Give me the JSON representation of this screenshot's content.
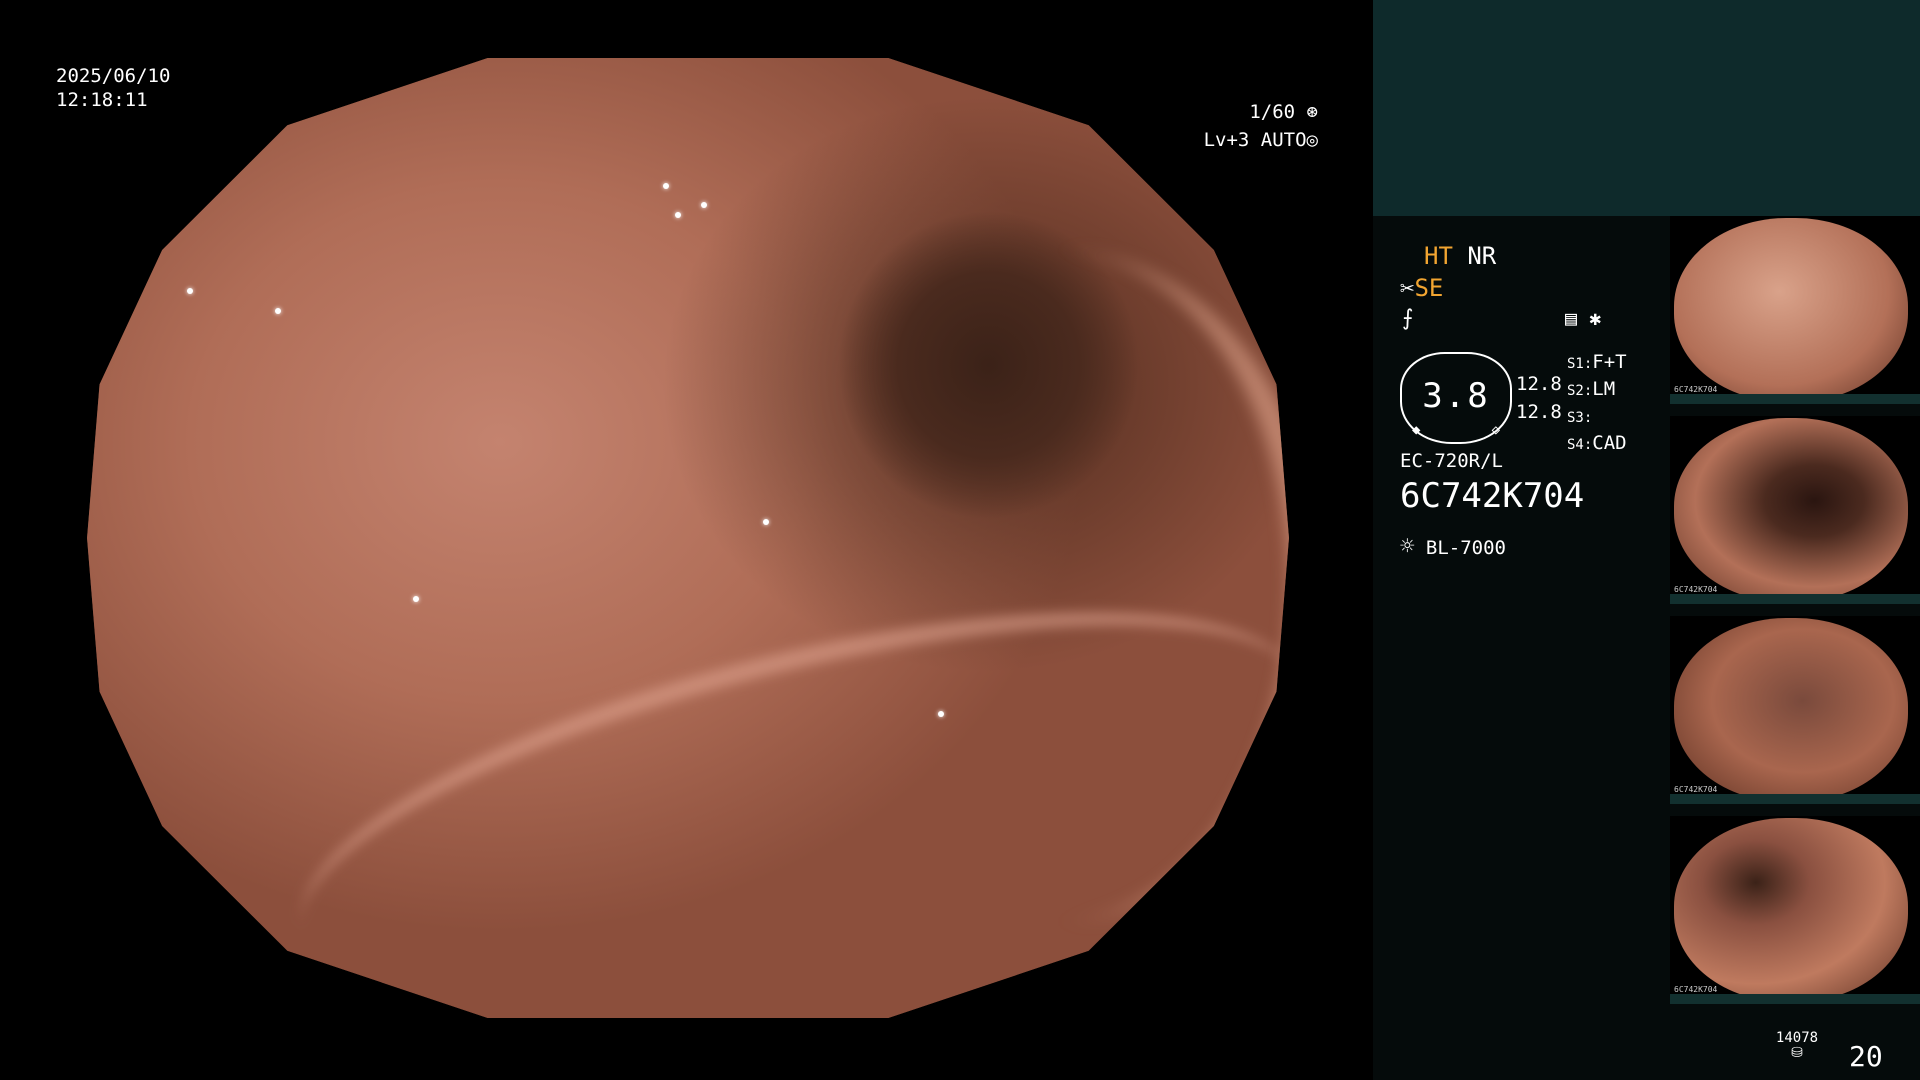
{
  "overlay": {
    "date": "2025/06/10",
    "time": "12:18:11",
    "shutter": "1/60",
    "level": "Lv+3",
    "mode": "AUTO"
  },
  "panel": {
    "ht": "HT",
    "nr": "NR",
    "se": "SE",
    "gauge_value": "3.8",
    "gauge_right_top": "12.8",
    "gauge_right_bottom": "12.8",
    "s1_key": "S1:",
    "s1_val": "F+T",
    "s2_key": "S2:",
    "s2_val": "LM",
    "s3_key": "S3:",
    "s3_val": "",
    "s4_key": "S4:",
    "s4_val": "CAD",
    "scope_model": "EC-720R/L",
    "scope_serial": "6C742K704",
    "light_source": "BL-7000",
    "storage_count": "14078",
    "image_count": "20"
  },
  "thumbnails": [
    {
      "label": "6C742K704",
      "color": "#c98a6e"
    },
    {
      "label": "6C742K704",
      "color": "#b8765c"
    },
    {
      "label": "6C742K704",
      "color": "#a9664e"
    },
    {
      "label": "6C742K704",
      "color": "#bf7a5f"
    }
  ],
  "colors": {
    "accent": "#f2a531",
    "panel_top": "#0e2a2b",
    "panel_bg": "#050b0b"
  }
}
